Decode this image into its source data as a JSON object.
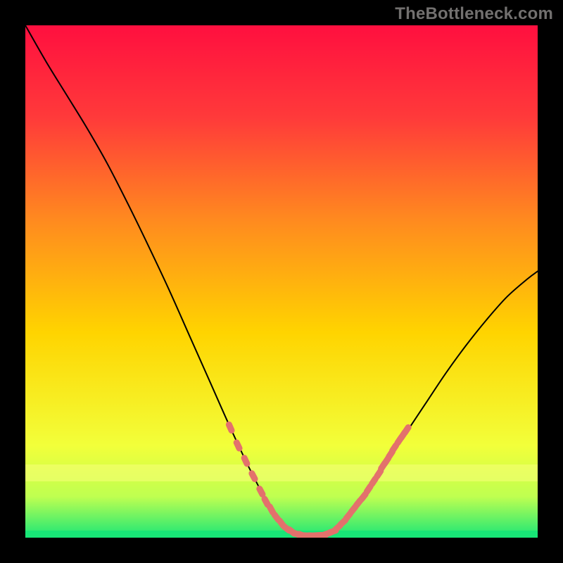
{
  "watermark": "TheBottleneck.com",
  "colors": {
    "frame": "#000000",
    "curve": "#000000",
    "marker": "#e3716c",
    "gradient_top": "#ff0f3f",
    "gradient_mid": "#ffd400",
    "gradient_bottom": "#18e677"
  },
  "chart_data": {
    "type": "line",
    "title": "",
    "xlabel": "",
    "ylabel": "",
    "xlim": [
      0,
      100
    ],
    "ylim": [
      0,
      100
    ],
    "grid": false,
    "legend": false,
    "series": [
      {
        "name": "bottleneck-curve",
        "x": [
          0,
          4,
          8,
          12,
          16,
          20,
          24,
          28,
          32,
          36,
          40,
          44,
          48,
          50,
          52,
          54,
          56,
          58,
          60,
          62,
          66,
          70,
          74,
          78,
          82,
          86,
          90,
          94,
          98,
          100
        ],
        "y": [
          100,
          93,
          86.5,
          80,
          73,
          65.2,
          57,
          48.5,
          39.5,
          30.5,
          21.5,
          13,
          5.5,
          2.8,
          1.2,
          0.5,
          0.4,
          0.5,
          1.2,
          3,
          8,
          14,
          20,
          26,
          32,
          37.5,
          42.5,
          47,
          50.5,
          52
        ]
      }
    ],
    "markers": [
      {
        "x": 40.0,
        "y": 21.5
      },
      {
        "x": 41.5,
        "y": 18.0
      },
      {
        "x": 43.0,
        "y": 15.0
      },
      {
        "x": 44.5,
        "y": 12.0
      },
      {
        "x": 46.0,
        "y": 9.0
      },
      {
        "x": 47.0,
        "y": 7.0
      },
      {
        "x": 48.0,
        "y": 5.5
      },
      {
        "x": 49.0,
        "y": 4.0
      },
      {
        "x": 50.0,
        "y": 2.8
      },
      {
        "x": 51.0,
        "y": 1.8
      },
      {
        "x": 52.0,
        "y": 1.2
      },
      {
        "x": 53.0,
        "y": 0.7
      },
      {
        "x": 54.0,
        "y": 0.5
      },
      {
        "x": 55.0,
        "y": 0.4
      },
      {
        "x": 56.0,
        "y": 0.4
      },
      {
        "x": 57.0,
        "y": 0.45
      },
      {
        "x": 58.0,
        "y": 0.5
      },
      {
        "x": 59.0,
        "y": 0.8
      },
      {
        "x": 60.0,
        "y": 1.2
      },
      {
        "x": 61.0,
        "y": 2.0
      },
      {
        "x": 62.0,
        "y": 3.0
      },
      {
        "x": 63.0,
        "y": 4.2
      },
      {
        "x": 64.0,
        "y": 5.5
      },
      {
        "x": 65.0,
        "y": 6.8
      },
      {
        "x": 66.0,
        "y": 8.0
      },
      {
        "x": 67.0,
        "y": 9.5
      },
      {
        "x": 68.0,
        "y": 11.0
      },
      {
        "x": 69.0,
        "y": 12.5
      },
      {
        "x": 69.8,
        "y": 14.0
      },
      {
        "x": 70.5,
        "y": 15.0
      },
      {
        "x": 71.3,
        "y": 16.3
      },
      {
        "x": 72.0,
        "y": 17.5
      },
      {
        "x": 73.0,
        "y": 19.0
      },
      {
        "x": 73.7,
        "y": 20.0
      },
      {
        "x": 74.4,
        "y": 21.0
      }
    ]
  }
}
